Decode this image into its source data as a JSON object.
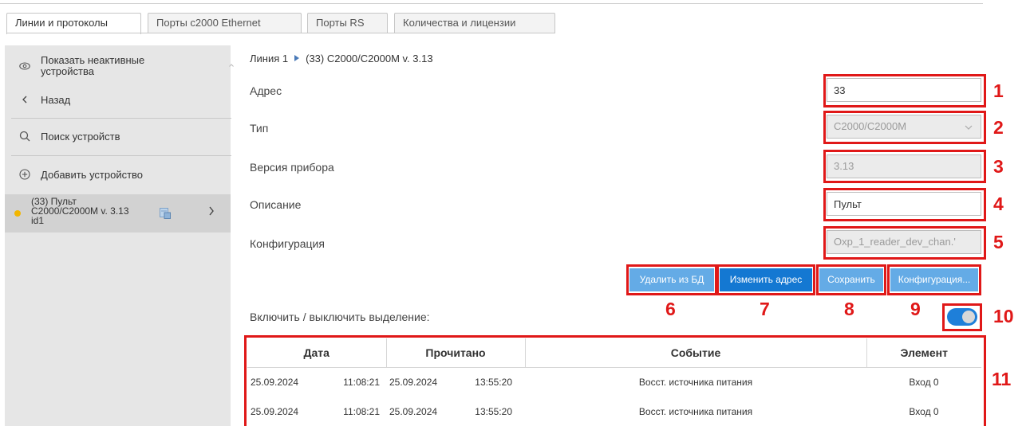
{
  "tabs": [
    {
      "label": "Линии и протоколы"
    },
    {
      "label": "Порты с2000 Ethernet"
    },
    {
      "label": "Порты RS"
    },
    {
      "label": "Количества и лицензии"
    }
  ],
  "sidebar": {
    "show_inactive": "Показать неактивные устройства",
    "back": "Назад",
    "search": "Поиск устройств",
    "add": "Добавить устройство",
    "device": {
      "line1": "(33) Пульт",
      "line2": "С2000/С2000М v. 3.13",
      "line3": "id1",
      "status_color": "#f2b600"
    }
  },
  "breadcrumb": {
    "line": "Линия 1",
    "device": "(33) С2000/С2000М v. 3.13"
  },
  "form": {
    "address_label": "Адрес",
    "address_value": "33",
    "type_label": "Тип",
    "type_value": "С2000/С2000М",
    "version_label": "Версия прибора",
    "version_value": "3.13",
    "description_label": "Описание",
    "description_value": "Пульт",
    "config_label": "Конфигурация",
    "config_value": "Oxp_1_reader_dev_chan.'"
  },
  "buttons": {
    "delete": "Удалить из БД",
    "change_address": "Изменить адрес",
    "save": "Сохранить",
    "configuration": "Конфигурация..."
  },
  "toggle": {
    "label": "Включить / выключить выделение:",
    "on": true
  },
  "table": {
    "headers": [
      "Дата",
      "Прочитано",
      "Событие",
      "Элемент"
    ],
    "rows": [
      {
        "date": "25.09.2024",
        "time": "11:08:21",
        "read_date": "25.09.2024",
        "read_time": "13:55:20",
        "event": "Восст. источника питания",
        "element": "Вход 0"
      },
      {
        "date": "25.09.2024",
        "time": "11:08:21",
        "read_date": "25.09.2024",
        "read_time": "13:55:20",
        "event": "Восст. источника питания",
        "element": "Вход 0"
      }
    ]
  },
  "annotations": [
    "1",
    "2",
    "3",
    "4",
    "5",
    "6",
    "7",
    "8",
    "9",
    "10",
    "11"
  ],
  "colors": {
    "annotation": "#e01818",
    "button_light": "#64abe6",
    "button_dark": "#1478d2",
    "toggle_on": "#1e7fd9"
  }
}
